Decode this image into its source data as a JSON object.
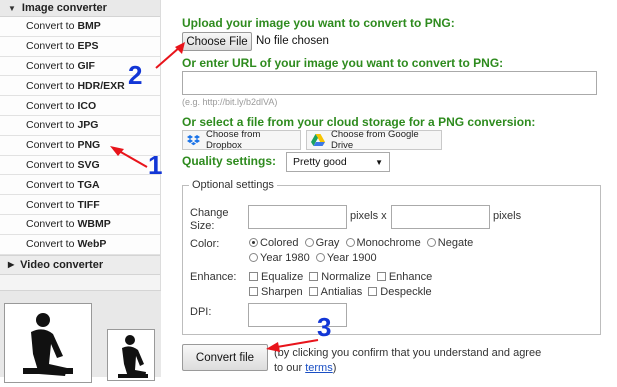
{
  "sidebar": {
    "section_image": "Image converter",
    "items": [
      {
        "prefix": "Convert to",
        "format": "BMP"
      },
      {
        "prefix": "Convert to",
        "format": "EPS"
      },
      {
        "prefix": "Convert to",
        "format": "GIF"
      },
      {
        "prefix": "Convert to",
        "format": "HDR/EXR"
      },
      {
        "prefix": "Convert to",
        "format": "ICO"
      },
      {
        "prefix": "Convert to",
        "format": "JPG"
      },
      {
        "prefix": "Convert to",
        "format": "PNG"
      },
      {
        "prefix": "Convert to",
        "format": "SVG"
      },
      {
        "prefix": "Convert to",
        "format": "TGA"
      },
      {
        "prefix": "Convert to",
        "format": "TIFF"
      },
      {
        "prefix": "Convert to",
        "format": "WBMP"
      },
      {
        "prefix": "Convert to",
        "format": "WebP"
      }
    ],
    "section_video": "Video converter"
  },
  "upload": {
    "heading": "Upload your image you want to convert to PNG:",
    "choose_label": "Choose File",
    "no_file": "No file chosen"
  },
  "url": {
    "heading": "Or enter URL of your image you want to convert to PNG:",
    "value": "",
    "hint": "(e.g. http://bit.ly/b2dlVA)"
  },
  "cloud": {
    "heading": "Or select a file from your cloud storage for a PNG conversion:",
    "dropbox": "Choose from Dropbox",
    "gdrive": "Choose from Google Drive"
  },
  "quality": {
    "label": "Quality settings:",
    "selected": "Pretty good"
  },
  "optional": {
    "legend": "Optional settings",
    "change_size_1": "Change",
    "change_size_2": "Size:",
    "pixels_x": "pixels x",
    "pixels": "pixels",
    "color_label": "Color:",
    "colors": [
      "Colored",
      "Gray",
      "Monochrome",
      "Negate",
      "Year 1980",
      "Year 1900"
    ],
    "enhance_label": "Enhance:",
    "enhance": [
      "Equalize",
      "Normalize",
      "Enhance",
      "Sharpen",
      "Antialias",
      "Despeckle"
    ],
    "dpi_label": "DPI:"
  },
  "convert": {
    "button": "Convert file",
    "note_1": "(by clicking you confirm that you understand and agree",
    "note_2": "to our",
    "terms": "terms",
    "note_3": ")"
  },
  "annotations": {
    "one": "1",
    "two": "2",
    "three": "3",
    "arrow_color": "#e8141b",
    "number_color": "#1236d6"
  }
}
